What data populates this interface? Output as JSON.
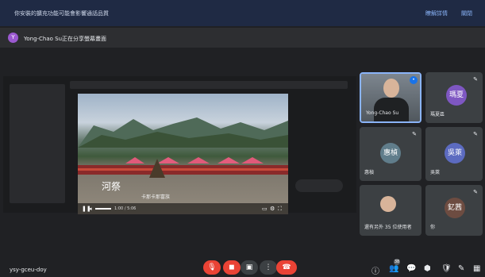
{
  "banner": {
    "title": "你安裝的擴充功能可能會影響通話品質",
    "action_primary": "瞭解詳情",
    "action_dismiss": "關閉"
  },
  "presenter_bar": {
    "avatar_letter": "Y",
    "text": "Yong-Chao Su正在分享螢幕畫面"
  },
  "shared_video": {
    "caption_main": "河祭",
    "caption_sub": "卡那卡那富族",
    "time": "1:00 / 5:06"
  },
  "participants": [
    {
      "name": "Yong-Chao Su",
      "type": "video",
      "speaking": true
    },
    {
      "name": "瑪夏區",
      "initials": "瑪夏",
      "color": "#7e57c2"
    },
    {
      "name": "惠楨",
      "initials": "惠楨",
      "color": "#607d8b"
    },
    {
      "name": "吳萊",
      "initials": "吳萊",
      "color": "#5c6bc0"
    },
    {
      "name": "還有另外 35 位使用者"
    },
    {
      "name": "你",
      "initials": "釔茜",
      "color": "#6d4c41"
    }
  ],
  "meeting": {
    "code": "ysy-gceu-doy"
  },
  "controls": {
    "people_count": "38"
  },
  "colors": {
    "end_call": "#ea4335",
    "accent": "#8ab4f8"
  }
}
